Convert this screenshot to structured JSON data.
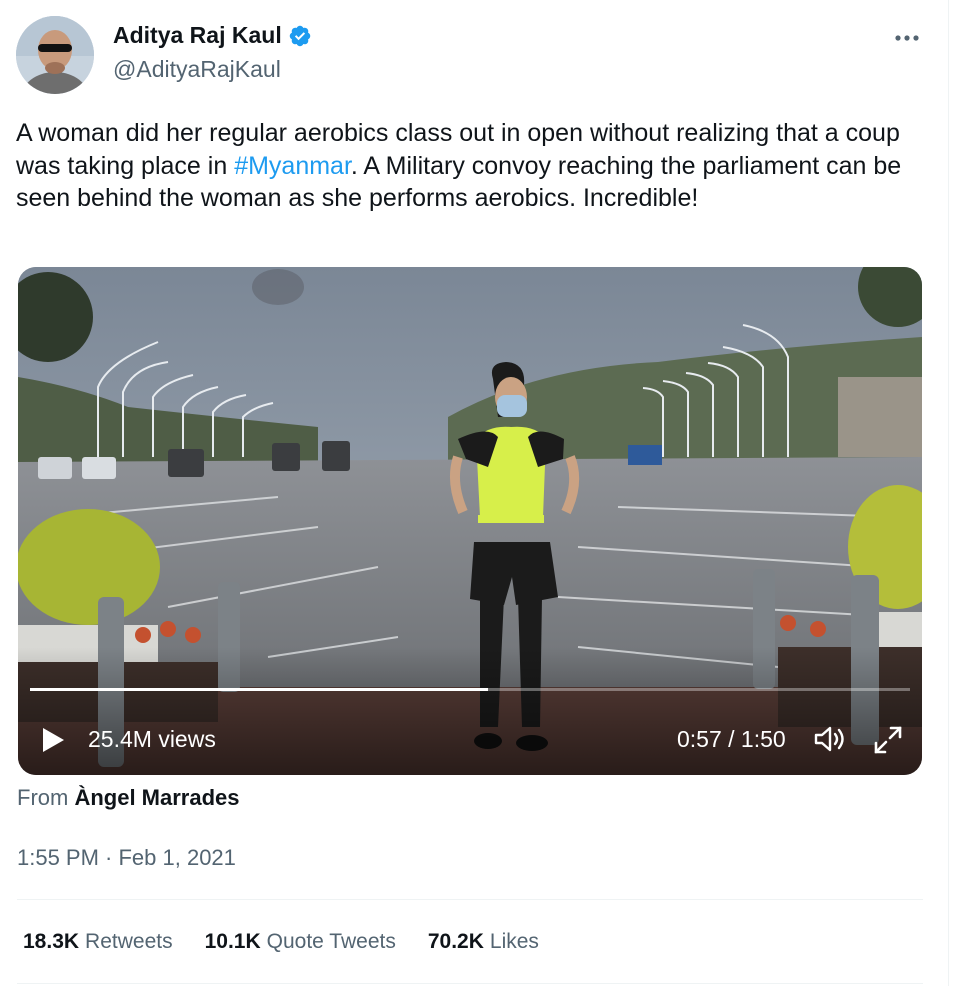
{
  "author": {
    "name": "Aditya Raj Kaul",
    "handle": "@AdityaRajKaul",
    "verified": true
  },
  "tweet": {
    "text_before_hashtag": "A woman did her regular aerobics class out in open without realizing that a coup was taking place in ",
    "hashtag": "#Myanmar",
    "text_after_hashtag": ". A Military convoy reaching the parliament can be seen behind the woman as she performs aerobics. Incredible!"
  },
  "video": {
    "views": "25.4M views",
    "time": "0:57 / 1:50",
    "progress_fraction": 0.52
  },
  "from": {
    "label": "From",
    "source": "Àngel Marrades"
  },
  "timestamp": "1:55 PM · Feb 1, 2021",
  "stats": {
    "retweets_count": "18.3K",
    "retweets_label": "Retweets",
    "quotes_count": "10.1K",
    "quotes_label": "Quote Tweets",
    "likes_count": "70.2K",
    "likes_label": "Likes"
  },
  "colors": {
    "link": "#1d9bf0",
    "text_primary": "#0f1419",
    "text_secondary": "#536471",
    "verified_badge": "#1d9bf0"
  },
  "icons": {
    "verified": "verified-badge-icon",
    "more": "more-dots-icon",
    "play": "play-icon",
    "volume": "volume-icon",
    "fullscreen": "fullscreen-icon"
  }
}
